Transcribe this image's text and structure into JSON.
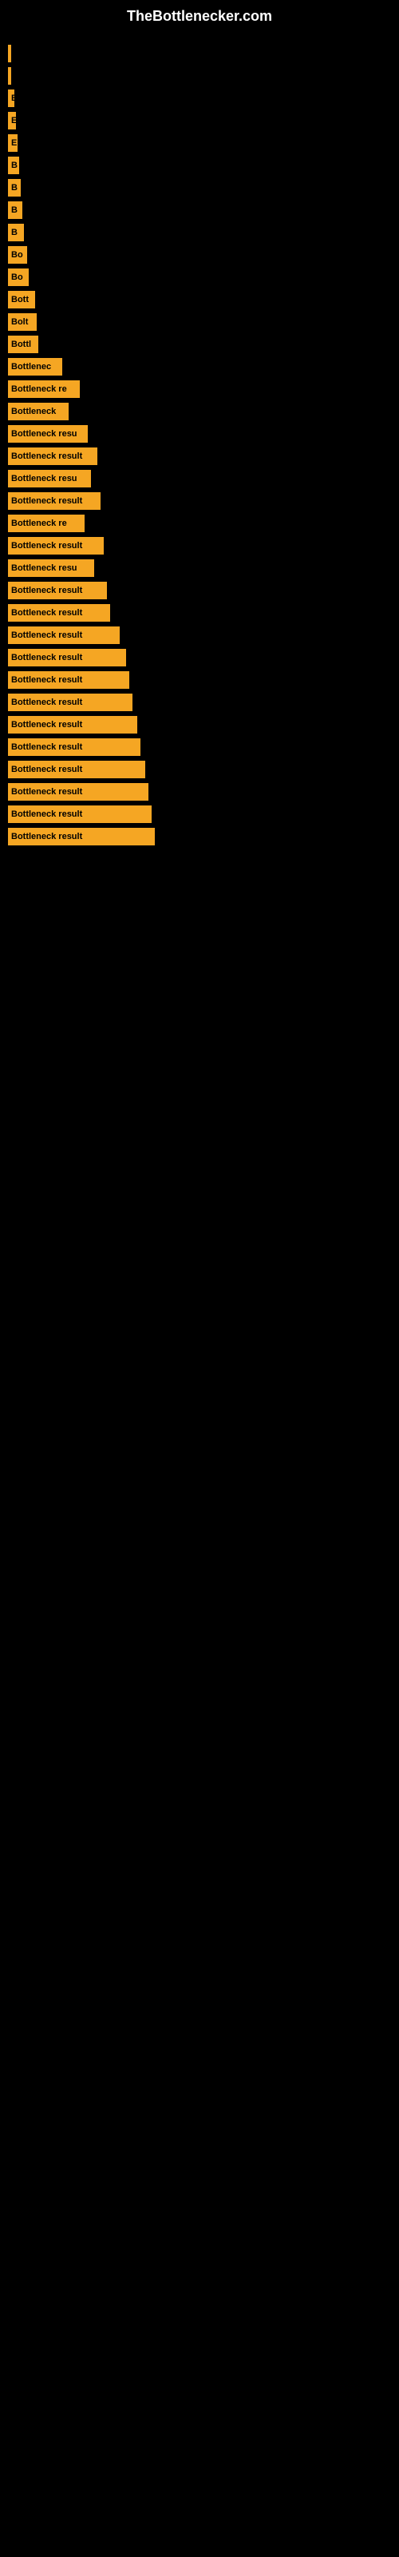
{
  "site": {
    "title": "TheBottlenecker.com"
  },
  "bars": [
    {
      "label": "",
      "width": 2
    },
    {
      "label": "",
      "width": 2
    },
    {
      "label": "E",
      "width": 8
    },
    {
      "label": "E",
      "width": 10
    },
    {
      "label": "E",
      "width": 12
    },
    {
      "label": "B",
      "width": 14
    },
    {
      "label": "B",
      "width": 16
    },
    {
      "label": "B",
      "width": 18
    },
    {
      "label": "B",
      "width": 20
    },
    {
      "label": "Bo",
      "width": 24
    },
    {
      "label": "Bo",
      "width": 26
    },
    {
      "label": "Bott",
      "width": 34
    },
    {
      "label": "Bolt",
      "width": 36
    },
    {
      "label": "Bottl",
      "width": 38
    },
    {
      "label": "Bottlenec",
      "width": 68
    },
    {
      "label": "Bottleneck re",
      "width": 90
    },
    {
      "label": "Bottleneck",
      "width": 76
    },
    {
      "label": "Bottleneck resu",
      "width": 100
    },
    {
      "label": "Bottleneck result",
      "width": 112
    },
    {
      "label": "Bottleneck resu",
      "width": 104
    },
    {
      "label": "Bottleneck result",
      "width": 116
    },
    {
      "label": "Bottleneck re",
      "width": 96
    },
    {
      "label": "Bottleneck result",
      "width": 120
    },
    {
      "label": "Bottleneck resu",
      "width": 108
    },
    {
      "label": "Bottleneck result",
      "width": 124
    },
    {
      "label": "Bottleneck result",
      "width": 128
    },
    {
      "label": "Bottleneck result",
      "width": 140
    },
    {
      "label": "Bottleneck result",
      "width": 148
    },
    {
      "label": "Bottleneck result",
      "width": 152
    },
    {
      "label": "Bottleneck result",
      "width": 156
    },
    {
      "label": "Bottleneck result",
      "width": 162
    },
    {
      "label": "Bottleneck result",
      "width": 166
    },
    {
      "label": "Bottleneck result",
      "width": 172
    },
    {
      "label": "Bottleneck result",
      "width": 176
    },
    {
      "label": "Bottleneck result",
      "width": 180
    },
    {
      "label": "Bottleneck result",
      "width": 184
    }
  ]
}
